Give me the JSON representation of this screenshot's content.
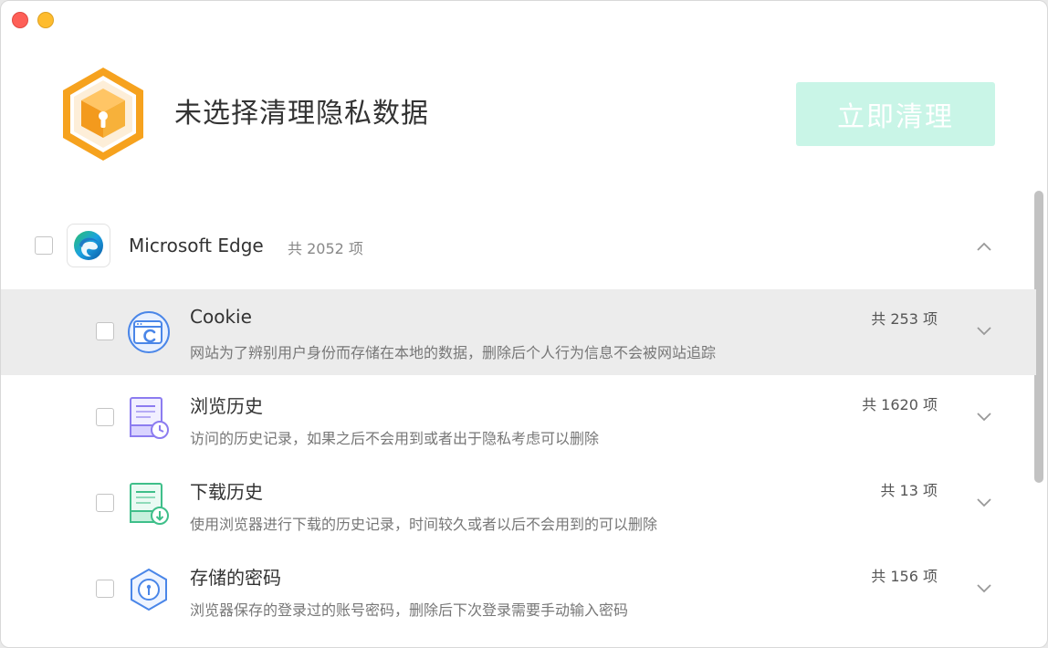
{
  "header": {
    "title": "未选择清理隐私数据",
    "clean_button": "立即清理"
  },
  "browser": {
    "name": "Microsoft Edge",
    "count": "共 2052 项",
    "icon": "edge-browser-icon"
  },
  "items": [
    {
      "title": "Cookie",
      "desc": "网站为了辨别用户身份而存储在本地的数据，删除后个人行为信息不会被网站追踪",
      "count": "共 253 项",
      "icon": "cookie-icon"
    },
    {
      "title": "浏览历史",
      "desc": "访问的历史记录，如果之后不会用到或者出于隐私考虑可以删除",
      "count": "共 1620 项",
      "icon": "history-icon"
    },
    {
      "title": "下载历史",
      "desc": "使用浏览器进行下载的历史记录，时间较久或者以后不会用到的可以删除",
      "count": "共 13 项",
      "icon": "download-history-icon"
    },
    {
      "title": "存储的密码",
      "desc": "浏览器保存的登录过的账号密码，删除后下次登录需要手动输入密码",
      "count": "共 156 项",
      "icon": "password-icon"
    }
  ],
  "colors": {
    "clean_button_bg": "#c9f5e7",
    "highlight_row": "#ececec",
    "logo_orange": "#f5a623"
  }
}
